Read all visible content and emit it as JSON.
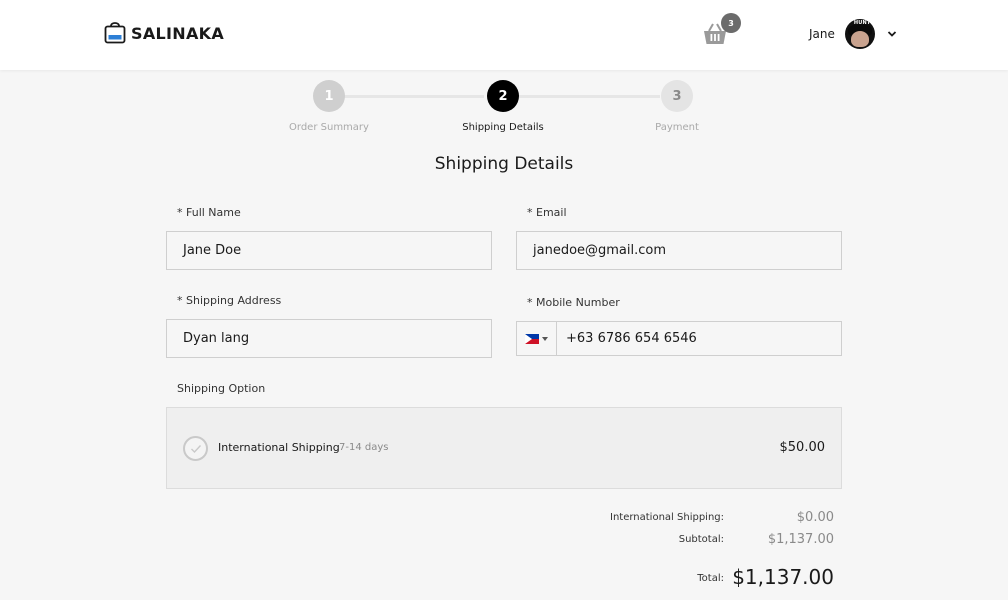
{
  "header": {
    "brand": "SALINAKA",
    "cart_count": "3",
    "user_name": "Jane",
    "avatar_text": "HUNT"
  },
  "stepper": {
    "steps": [
      {
        "number": "1",
        "label": "Order Summary",
        "state": "done"
      },
      {
        "number": "2",
        "label": "Shipping Details",
        "state": "active"
      },
      {
        "number": "3",
        "label": "Payment",
        "state": "todo"
      }
    ]
  },
  "page": {
    "title": "Shipping Details"
  },
  "form": {
    "full_name": {
      "label": "* Full Name",
      "value": "Jane Doe"
    },
    "email": {
      "label": "* Email",
      "value": "janedoe@gmail.com"
    },
    "shipping_address": {
      "label": "* Shipping Address",
      "value": "Dyan lang"
    },
    "mobile": {
      "label": "* Mobile Number",
      "value": "+63 6786 654 6546",
      "country": "Philippines"
    }
  },
  "shipping_option": {
    "label": "Shipping Option",
    "name": "International Shipping",
    "days": "7-14 days",
    "price": "$50.00"
  },
  "summary": {
    "shipping_label": "International Shipping:",
    "shipping_value": "$0.00",
    "subtotal_label": "Subtotal:",
    "subtotal_value": "$1,137.00",
    "total_label": "Total:",
    "total_value": "$1,137.00"
  },
  "colors": {
    "background": "#f6f6f6",
    "header": "#ffffff",
    "active_step": "#000000",
    "inactive_step": "#cfcfcf",
    "border": "#cfcfcf"
  }
}
